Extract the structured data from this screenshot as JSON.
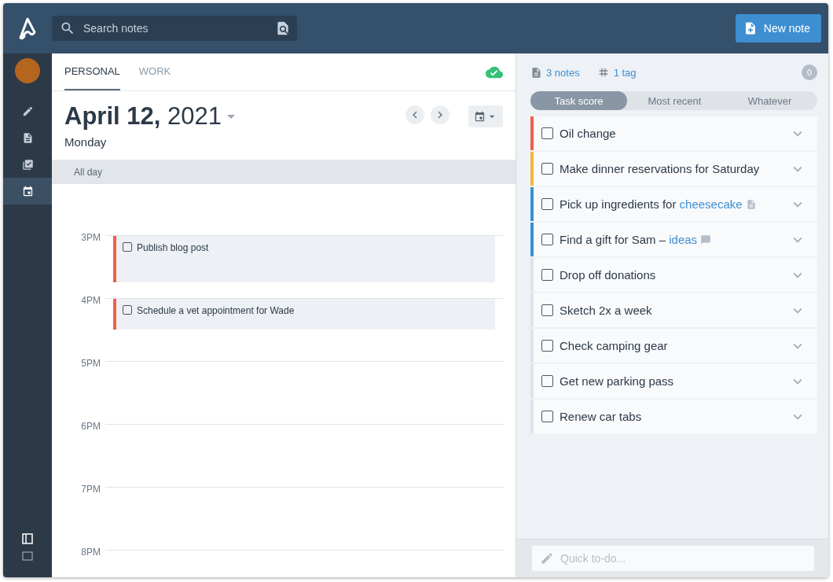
{
  "header": {
    "search": {
      "placeholder": "Search notes"
    },
    "new_button": "New note"
  },
  "sidebar": {
    "items": [
      {
        "selected": false
      },
      {
        "selected": false
      },
      {
        "selected": false
      },
      {
        "selected": true
      }
    ],
    "bottom": [
      {
        "selected": true
      },
      {
        "selected": false
      }
    ]
  },
  "tabs": [
    {
      "label": "PERSONAL",
      "selected": true
    },
    {
      "label": "WORK",
      "selected": false
    }
  ],
  "sync": {
    "synced": true
  },
  "date": {
    "title": "**April 12,** 2021",
    "weekday": "Monday"
  },
  "all_day": "All day",
  "hours": [
    {
      "label": "3PM",
      "events": [
        {
          "title": "Publish blog post",
          "checked": false,
          "kind": "tall",
          "color": "#f0604a"
        }
      ]
    },
    {
      "label": "4PM",
      "events": [
        {
          "title": "Schedule a vet appointment for Wade",
          "checked": false,
          "kind": "short",
          "color": "#f0604a"
        }
      ]
    },
    {
      "label": "5PM"
    },
    {
      "label": "6PM"
    },
    {
      "label": "7PM"
    },
    {
      "label": "8PM"
    }
  ],
  "stats": {
    "notes": "3 notes",
    "tags": "1 tag",
    "count": "0"
  },
  "sort_tabs": [
    {
      "label": "Task score",
      "selected": true
    },
    {
      "label": "Most recent",
      "selected": false
    },
    {
      "label": "Whatever",
      "selected": false
    }
  ],
  "tasks": [
    {
      "text": "Oil change",
      "checked": false,
      "color": "#f0604a"
    },
    {
      "text": "Make dinner reservations for Saturday",
      "checked": false,
      "color": "#f7b43c"
    },
    {
      "text": "Pick up ingredients for ",
      "link": "cheesecake",
      "kind": "note_link",
      "checked": false,
      "color": "#3b8fd0"
    },
    {
      "text": "Find a gift for Sam – ",
      "link": "ideas",
      "kind": "comment_link",
      "checked": false,
      "color": "#3b8fd0"
    },
    {
      "text": "Drop off donations",
      "checked": false,
      "color": "#dfe4ea"
    },
    {
      "text": "Sketch 2x a week",
      "checked": false,
      "color": "#dfe4ea"
    },
    {
      "text": "Check camping gear",
      "checked": false,
      "color": "#dfe4ea"
    },
    {
      "text": "Get new parking pass",
      "checked": false,
      "color": "#dfe4ea"
    },
    {
      "text": "Renew car tabs",
      "checked": false,
      "color": "#dfe4ea"
    }
  ],
  "quick_todo": {
    "placeholder": "Quick to-do..."
  }
}
